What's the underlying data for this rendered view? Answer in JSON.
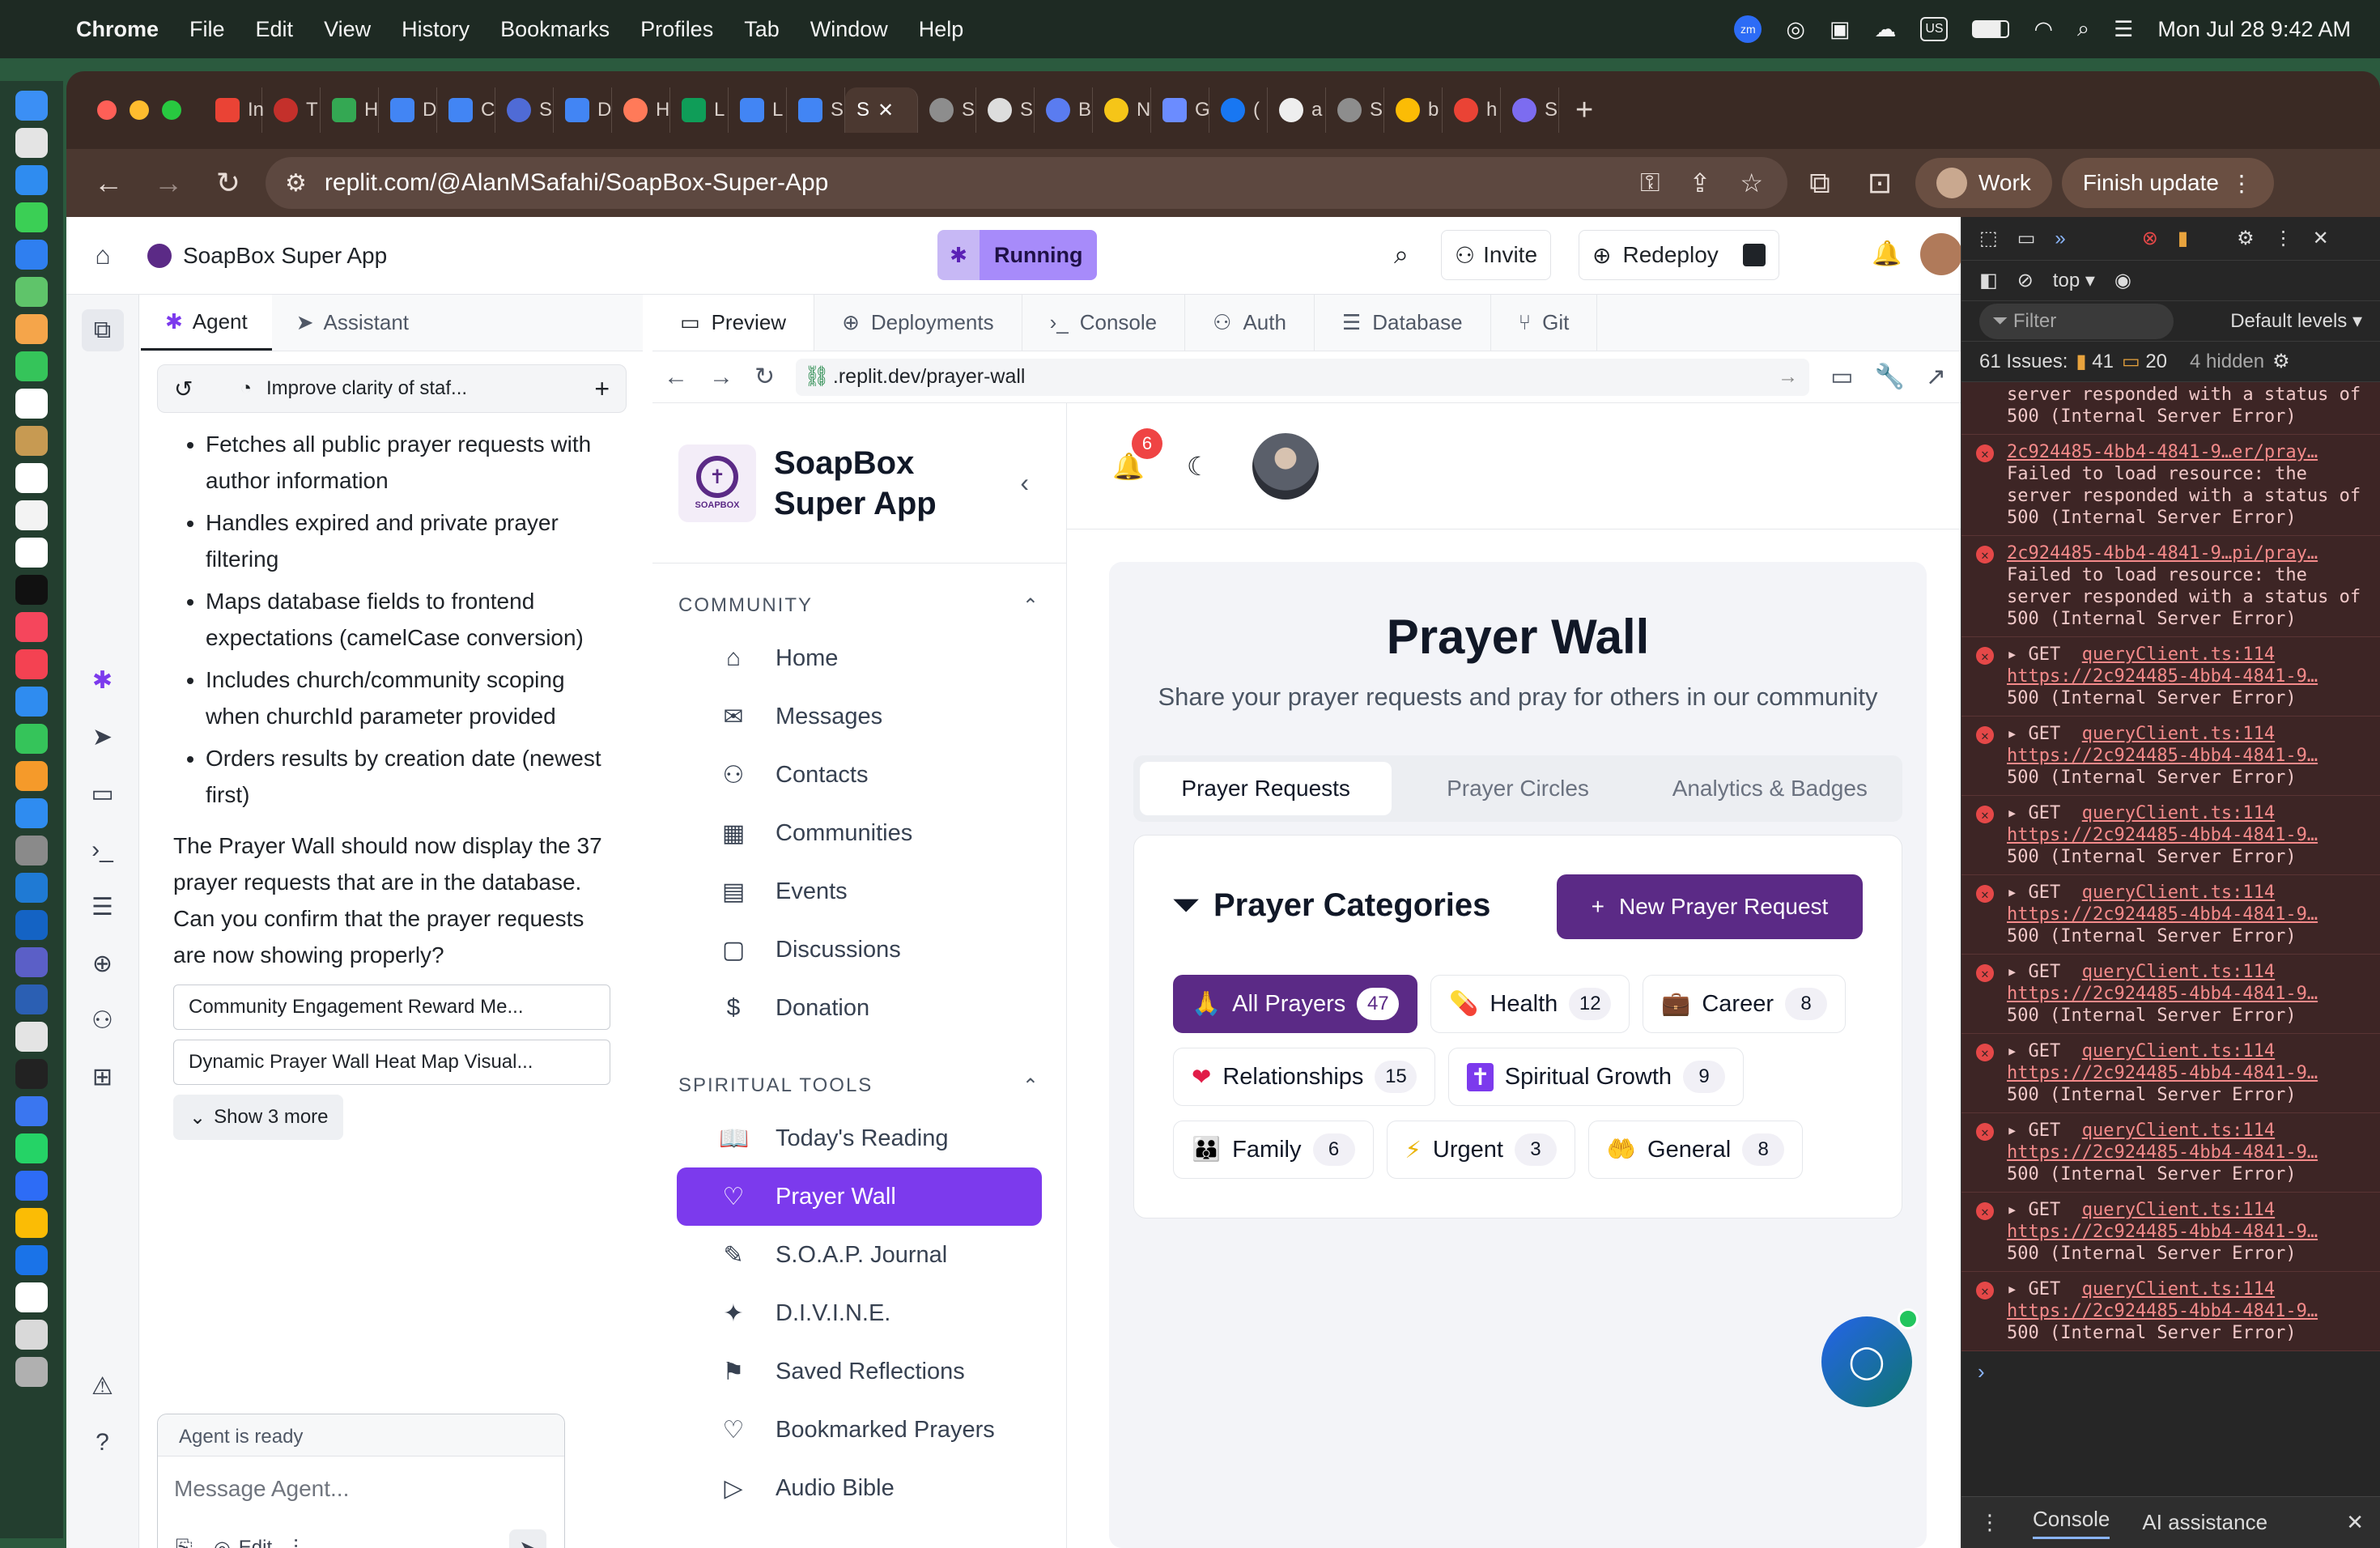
{
  "menubar": {
    "app": "Chrome",
    "items": [
      "File",
      "Edit",
      "View",
      "History",
      "Bookmarks",
      "Profiles",
      "Tab",
      "Window",
      "Help"
    ],
    "input_source": "US",
    "clock": "Mon Jul 28  9:42 AM"
  },
  "browser": {
    "url": "replit.com/@AlanMSafahi/SoapBox-Super-App",
    "profile": "Work",
    "update_label": "Finish update",
    "tabs": [
      "In",
      "T",
      "H",
      "D",
      "C",
      "S",
      "D",
      "H",
      "L",
      "L",
      "S",
      "S",
      "S",
      "S",
      "B",
      "N",
      "G",
      "(",
      "a",
      "S",
      "b",
      "h",
      "S"
    ]
  },
  "replit": {
    "app_title": "SoapBox Super App",
    "status": "Running",
    "invite": "Invite",
    "redeploy": "Redeploy"
  },
  "agent": {
    "tabs": [
      "Agent",
      "Assistant"
    ],
    "thread_title": "Improve clarity of staf...",
    "bullets": [
      "Fetches all public prayer requests with author information",
      "Handles expired and private prayer filtering",
      "Maps database fields to frontend expectations (camelCase conversion)",
      "Includes church/community scoping when churchId parameter provided",
      "Orders results by creation date (newest first)"
    ],
    "message": "The Prayer Wall should now display the 37 prayer requests that are in the database. Can you confirm that the prayer requests are now showing properly?",
    "suggestions": [
      "Community Engagement Reward Me...",
      "Dynamic Prayer Wall Heat Map Visual..."
    ],
    "show_more": "Show 3 more",
    "status": "Agent is ready",
    "placeholder": "Message Agent...",
    "edit": "Edit"
  },
  "preview": {
    "tabs": [
      "Preview",
      "Deployments",
      "Console",
      "Auth",
      "Database",
      "Git"
    ],
    "url": ".replit.dev/prayer-wall"
  },
  "site": {
    "brand": "SoapBox Super App",
    "logo_text": "SOAPBOX",
    "notif_count": "6",
    "sections": [
      {
        "title": "COMMUNITY",
        "items": [
          "Home",
          "Messages",
          "Contacts",
          "Communities",
          "Events",
          "Discussions",
          "Donation"
        ]
      },
      {
        "title": "SPIRITUAL TOOLS",
        "items": [
          "Today's Reading",
          "Prayer Wall",
          "S.O.A.P. Journal",
          "D.I.V.I.N.E.",
          "Saved Reflections",
          "Bookmarked Prayers",
          "Audio Bible"
        ]
      }
    ],
    "title": "Prayer Wall",
    "subtitle": "Share your prayer requests and pray for others in our community",
    "tabs": [
      "Prayer Requests",
      "Prayer Circles",
      "Analytics & Badges"
    ],
    "categories_title": "Prayer Categories",
    "new_button": "New Prayer Request",
    "categories": [
      {
        "label": "All Prayers",
        "count": "47",
        "icon": "🙏"
      },
      {
        "label": "Health",
        "count": "12",
        "icon": "💊"
      },
      {
        "label": "Career",
        "count": "8",
        "icon": "💼"
      },
      {
        "label": "Relationships",
        "count": "15",
        "icon": "❤"
      },
      {
        "label": "Spiritual Growth",
        "count": "9",
        "icon": "✝"
      },
      {
        "label": "Family",
        "count": "6",
        "icon": "👪"
      },
      {
        "label": "Urgent",
        "count": "3",
        "icon": "⚡"
      },
      {
        "label": "General",
        "count": "8",
        "icon": "🤲"
      }
    ]
  },
  "devtools": {
    "context": "top",
    "filter": "Filter",
    "levels": "Default levels",
    "issues": "61 Issues:",
    "errors": "41",
    "warnings": "20",
    "hidden": "4 hidden",
    "log_head": "server responded with a status of 500 (Internal Server Error)",
    "fail_links": [
      "2c924485-4bb4-4841-9…er/pray…",
      "2c924485-4bb4-4841-9…pi/pray…"
    ],
    "fail_text": "Failed to load resource: the server responded with a status of 500 (Internal Server Error)",
    "get_source": "queryClient.ts:114",
    "get_url": "https://2c924485-4bb4-4841-9…",
    "get_status": "500 (Internal Server Error)",
    "get_label": "GET",
    "bottom_tabs": [
      "Console",
      "AI assistance"
    ]
  },
  "colors": {
    "accent": "#5b2a86",
    "active_nav": "#7c3aed",
    "running": "#a78bfa"
  }
}
